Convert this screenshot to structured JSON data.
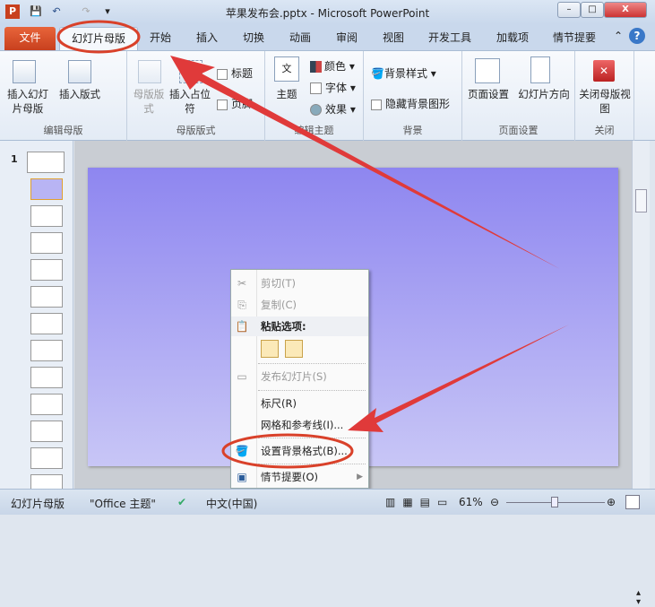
{
  "window": {
    "title": "苹果发布会.pptx - Microsoft PowerPoint",
    "minimize": "–",
    "maximize": "□",
    "close": "X"
  },
  "quick_access": {
    "app_icon": "P",
    "save": "💾",
    "undo": "↶",
    "redo": "↷",
    "customize": "▾"
  },
  "tabs": {
    "file": "文件",
    "active": "幻灯片母版",
    "items": [
      "开始",
      "插入",
      "切换",
      "动画",
      "审阅",
      "视图",
      "开发工具",
      "加载项",
      "情节提要"
    ],
    "collapse": "⌃",
    "help": "?"
  },
  "ribbon": {
    "edit_master": {
      "label": "编辑母版",
      "insert_master": "插入幻灯片母版",
      "insert_layout": "插入版式"
    },
    "master_layout": {
      "label": "母版版式",
      "master_layout_btn": "母版版式",
      "insert_placeholder": "插入占位符",
      "title_cb": "标题",
      "footer_cb": "页脚"
    },
    "edit_theme": {
      "label": "编辑主题",
      "theme": "主题",
      "colors": "颜色",
      "fonts": "字体",
      "effects": "效果"
    },
    "background": {
      "label": "背景",
      "styles": "背景样式",
      "hide_graphics": "隐藏背景图形"
    },
    "page_setup": {
      "label": "页面设置",
      "setup": "页面设置",
      "orientation": "幻灯片方向"
    },
    "close": {
      "label": "关闭",
      "close_master": "关闭母版视图"
    }
  },
  "thumbnails": {
    "first_number": "1",
    "count": 13
  },
  "context_menu": {
    "cut": "剪切(T)",
    "copy": "复制(C)",
    "paste_options": "粘贴选项:",
    "publish": "发布幻灯片(S)",
    "ruler": "标尺(R)",
    "grid": "网格和参考线(I)...",
    "format_bg": "设置背景格式(B)...",
    "storyboard": "情节提要(O)"
  },
  "status": {
    "view": "幻灯片母版",
    "theme": "\"Office 主题\"",
    "language": "中文(中国)",
    "zoom": "61%",
    "zoom_percent": 61
  },
  "colors": {
    "accent": "#d9412a",
    "annotation": "#e03a3a"
  }
}
